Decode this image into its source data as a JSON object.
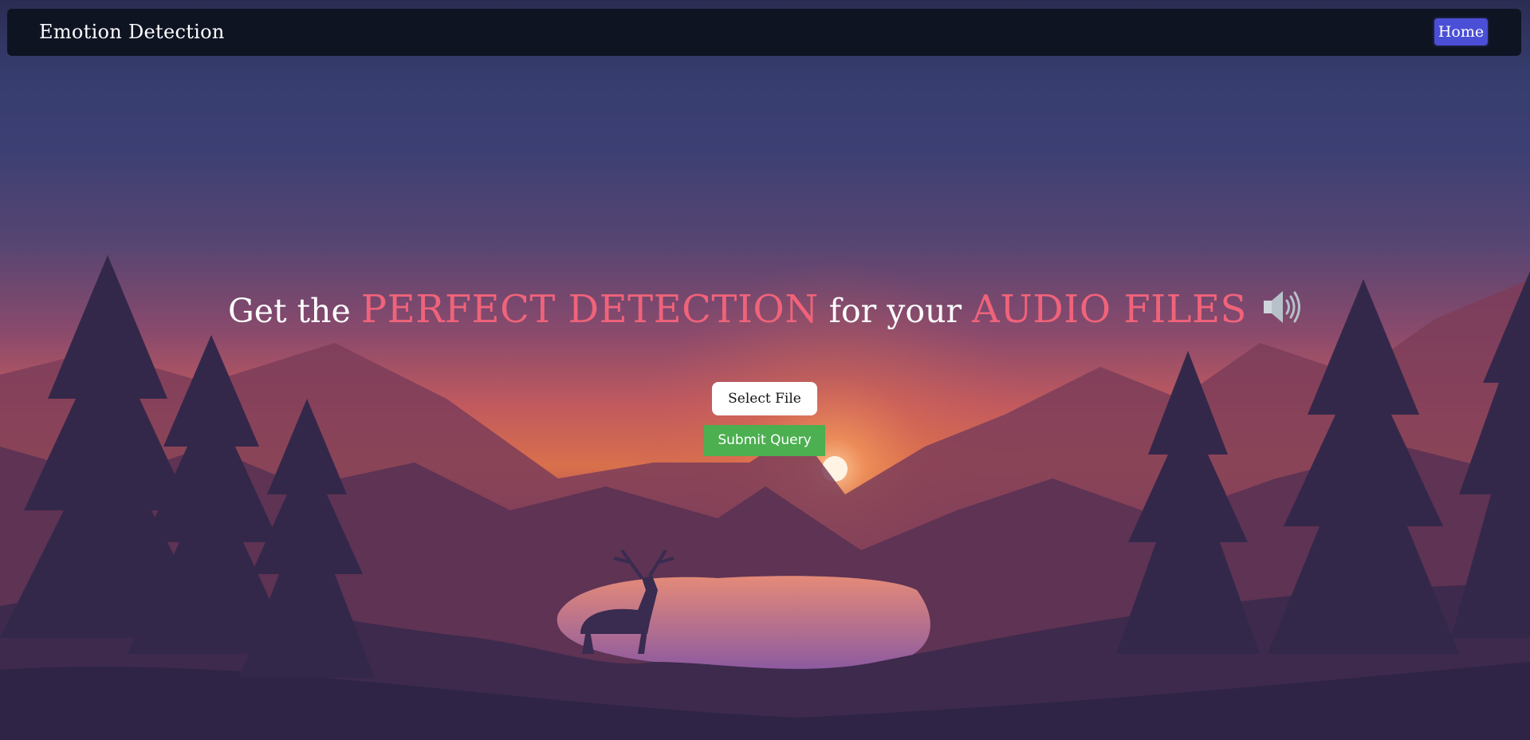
{
  "navbar": {
    "brand": "Emotion Detection",
    "home_label": "Home"
  },
  "hero": {
    "part1": "Get the",
    "accent1": "PERFECT DETECTION",
    "part2": "for your",
    "accent2": "AUDIO FILES",
    "icon": "speaker-icon"
  },
  "upload": {
    "select_label": "Select File",
    "submit_label": "Submit Query"
  },
  "colors": {
    "navbar_bg": "#0f1423",
    "home_button": "#4a4fd6",
    "accent_text": "#f0637a",
    "submit_button": "#4caf50"
  }
}
